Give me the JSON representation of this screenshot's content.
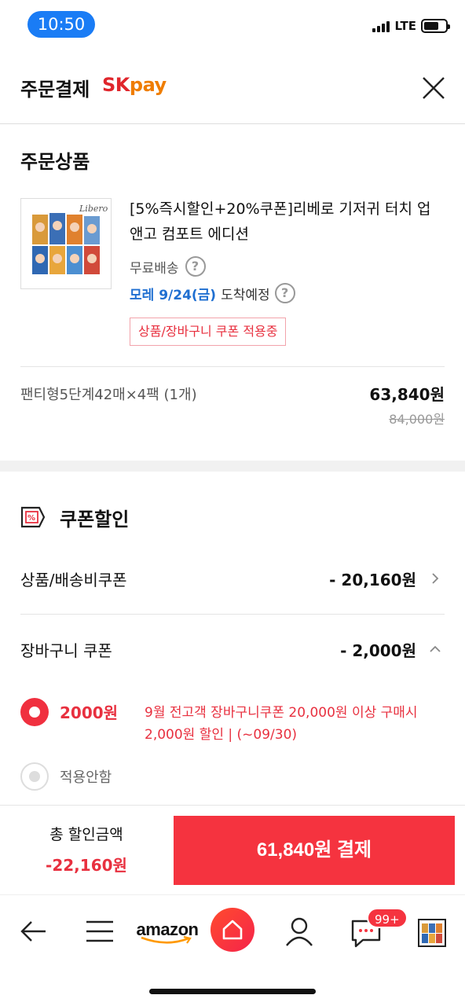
{
  "status": {
    "time": "10:50",
    "network": "LTE"
  },
  "header": {
    "title": "주문결제",
    "brand_sk": "SK",
    "brand_pay": "pay",
    "close_icon": "close-icon"
  },
  "order": {
    "section_title": "주문상품",
    "product_name": "[5%즉시할인+20%쿠폰]리베로 기저귀 터치 업앤고 컴포트 에디션",
    "shipping": "무료배송",
    "arrival_date": "모레 9/24(금)",
    "arrival_suffix": "도착예정",
    "coupon_tag": "상품/장바구니 쿠폰 적용중",
    "option": "팬티형5단계42매×4팩 (1개)",
    "price": "63,840원",
    "original_price": "84,000원"
  },
  "coupon": {
    "section_title": "쿠폰할인",
    "product_coupon_label": "상품/배송비쿠폰",
    "product_coupon_value": "- 20,160원",
    "cart_coupon_label": "장바구니 쿠폰",
    "cart_coupon_value": "- 2,000원",
    "selected_option_value": "2000원",
    "selected_option_desc": "9월 전고객 장바구니쿠폰 20,000원 이상 구매시 2,000원 할인 | (~09/30)",
    "none_option_label": "적용안함"
  },
  "paybar": {
    "total_label": "총 할인금액",
    "total_value": "-22,160원",
    "pay_button": "61,840원 결제"
  },
  "nav": {
    "amazon_label": "amazon",
    "badge": "99+"
  },
  "colors": {
    "accent_red": "#f5333f",
    "link_blue": "#1f6fd1",
    "sk_red": "#e0262c",
    "sk_orange": "#ef7d00"
  }
}
